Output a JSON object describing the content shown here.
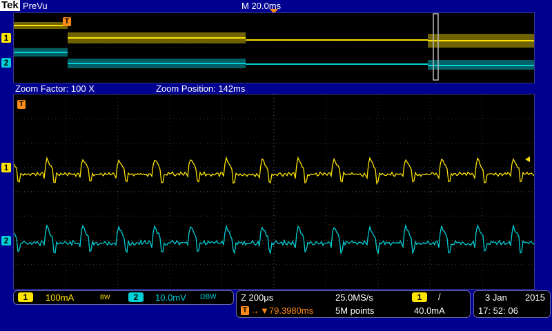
{
  "header": {
    "brand": "Tek",
    "mode": "PreVu",
    "time_per_div": "M 20.0ms"
  },
  "zoom": {
    "factor_label": "Zoom Factor: 100 X",
    "position_label": "Zoom Position: 142ms"
  },
  "markers": {
    "trigger": "T",
    "ch1": "1",
    "ch2": "2"
  },
  "channels": {
    "ch1": {
      "id": "1",
      "scale": "100mA",
      "bw": "BW",
      "color": "#ffe400"
    },
    "ch2": {
      "id": "2",
      "scale": "10.0mV",
      "bw": "ΩBW",
      "color": "#00d0d8"
    }
  },
  "timebase": {
    "zoom_scale": "Z 200μs",
    "sample_rate": "25.0MS/s",
    "trigger_offset": "▼79.3980ms",
    "record_length": "5M points",
    "trigger_source": "1",
    "trigger_slope": "/",
    "trigger_level": "40.0mA"
  },
  "datetime": {
    "date": "3 Jan",
    "year": "2015",
    "time": "17: 52: 06"
  }
}
